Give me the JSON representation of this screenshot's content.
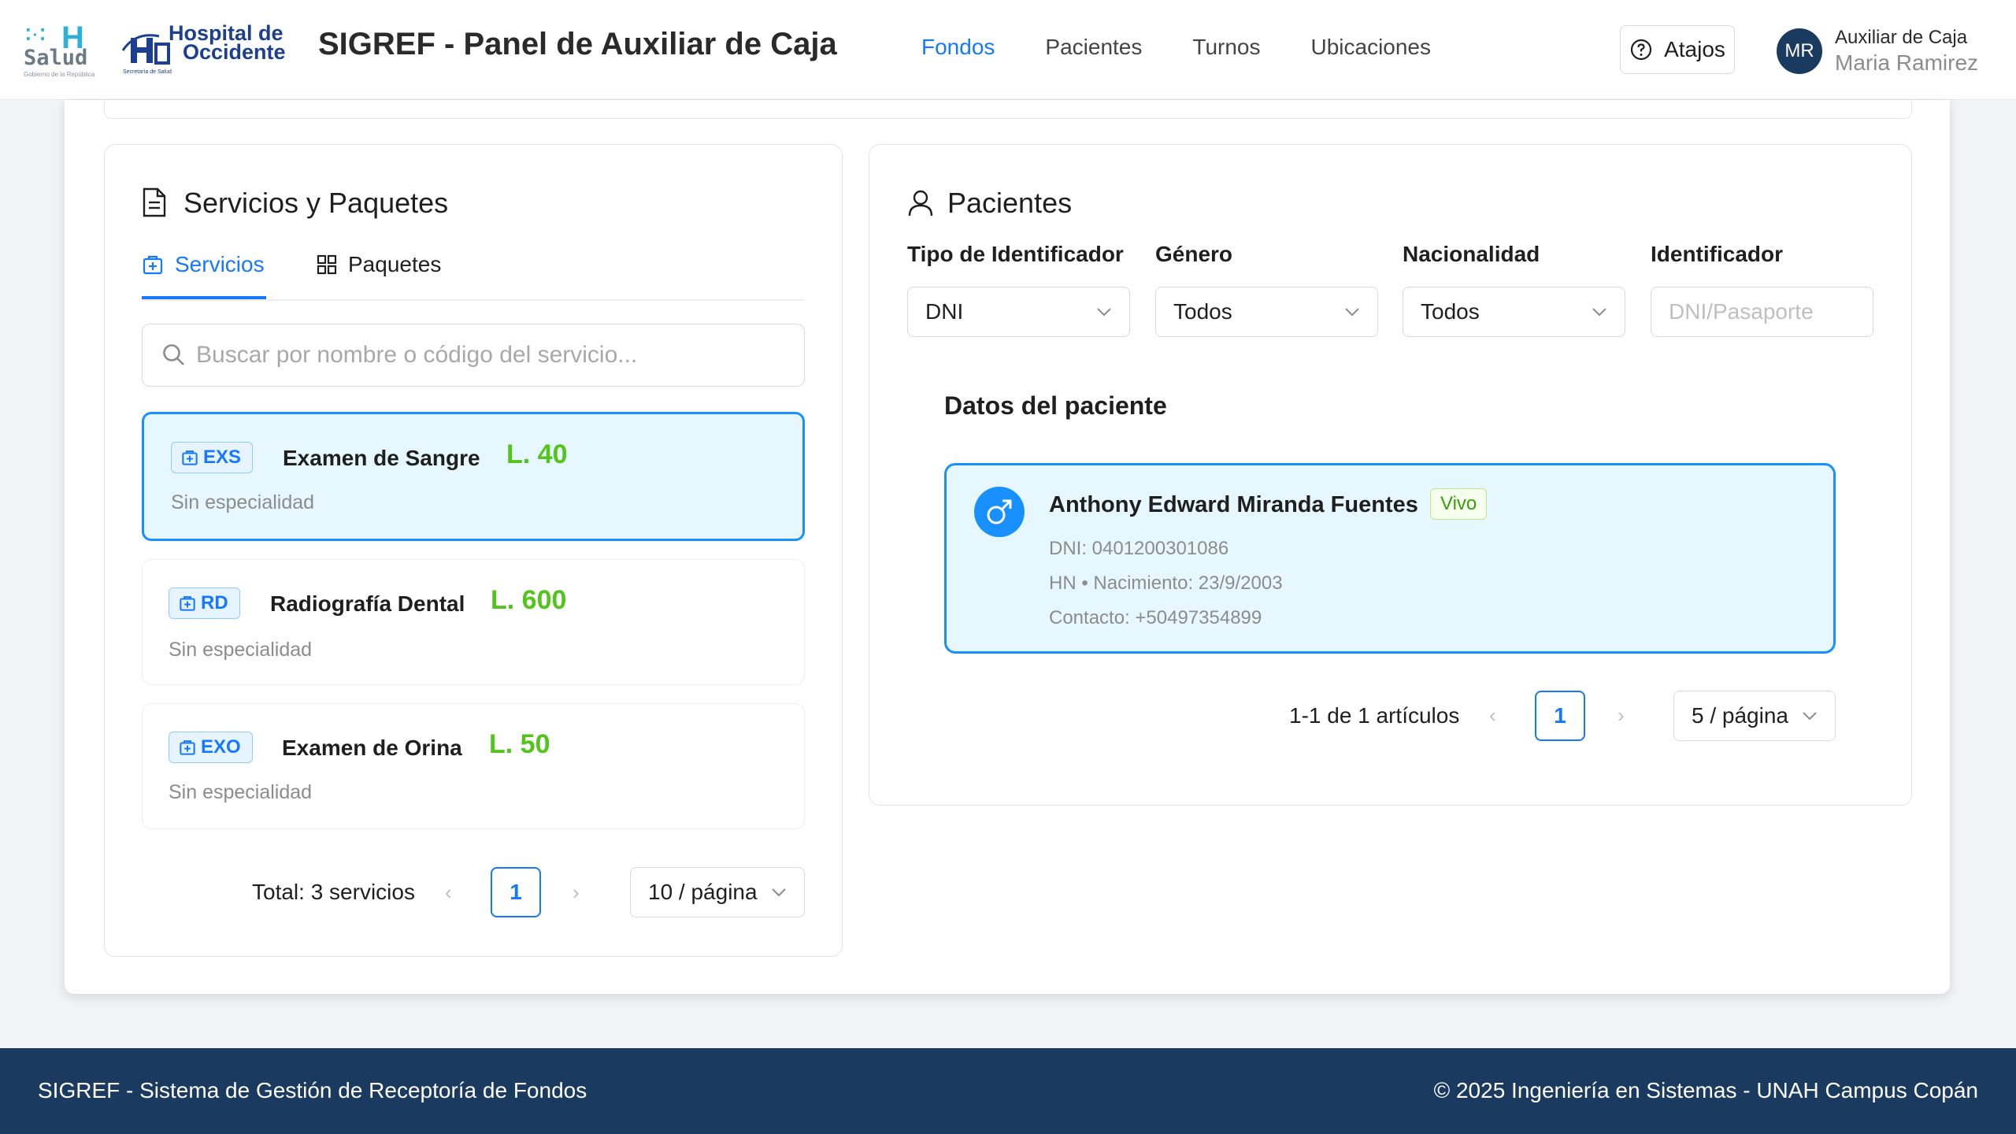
{
  "brand": {
    "salud_logo_text": "Salud",
    "salud_logo_subtext": "Gobierno de la República",
    "hospital_logo_line1": "Hospital de",
    "hospital_logo_line2": "Occidente",
    "hospital_logo_subtext": "Secretaría de Salud"
  },
  "header": {
    "title": "SIGREF - Panel de Auxiliar de Caja",
    "nav": [
      "Fondos",
      "Pacientes",
      "Turnos",
      "Ubicaciones"
    ],
    "active_nav": "Fondos",
    "shortcuts_label": "Atajos",
    "user": {
      "initials": "MR",
      "role": "Auxiliar de Caja",
      "name": "Maria Ramirez"
    }
  },
  "services_panel": {
    "title": "Servicios y Paquetes",
    "tabs": [
      "Servicios",
      "Paquetes"
    ],
    "active_tab": "Servicios",
    "search_placeholder": "Buscar por nombre o código del servicio...",
    "items": [
      {
        "code": "EXS",
        "name": "Examen de Sangre",
        "price": "L. 40",
        "specialty": "Sin especialidad",
        "selected": true
      },
      {
        "code": "RD",
        "name": "Radiografía Dental",
        "price": "L. 600",
        "specialty": "Sin especialidad",
        "selected": false
      },
      {
        "code": "EXO",
        "name": "Examen de Orina",
        "price": "L. 50",
        "specialty": "Sin especialidad",
        "selected": false
      }
    ],
    "pagination": {
      "total_text": "Total: 3 servicios",
      "current_page": "1",
      "page_size": "10 / página"
    }
  },
  "patients_panel": {
    "title": "Pacientes",
    "filters": {
      "id_type": {
        "label": "Tipo de Identificador",
        "value": "DNI"
      },
      "gender": {
        "label": "Género",
        "value": "Todos"
      },
      "nationality": {
        "label": "Nacionalidad",
        "value": "Todos"
      },
      "identifier": {
        "label": "Identificador",
        "placeholder": "DNI/Pasaporte",
        "value": ""
      }
    },
    "section_title": "Datos del paciente",
    "patient": {
      "name": "Anthony Edward Miranda Fuentes",
      "status": "Vivo",
      "dni": "DNI: 0401200301086",
      "birth": "HN • Nacimiento: 23/9/2003",
      "contact": "Contacto: +50497354899"
    },
    "pagination": {
      "range_text": "1-1 de 1 artículos",
      "current_page": "1",
      "page_size": "5 / página"
    }
  },
  "footer": {
    "left": "SIGREF - Sistema de Gestión de Receptoría de Fondos",
    "right": "© 2025 Ingeniería en Sistemas - UNAH Campus Copán"
  },
  "colors": {
    "primary": "#1677ff",
    "price_green": "#52c41a",
    "footer_bg": "#1a3a5f",
    "selected_bg": "#e6f7ff"
  }
}
